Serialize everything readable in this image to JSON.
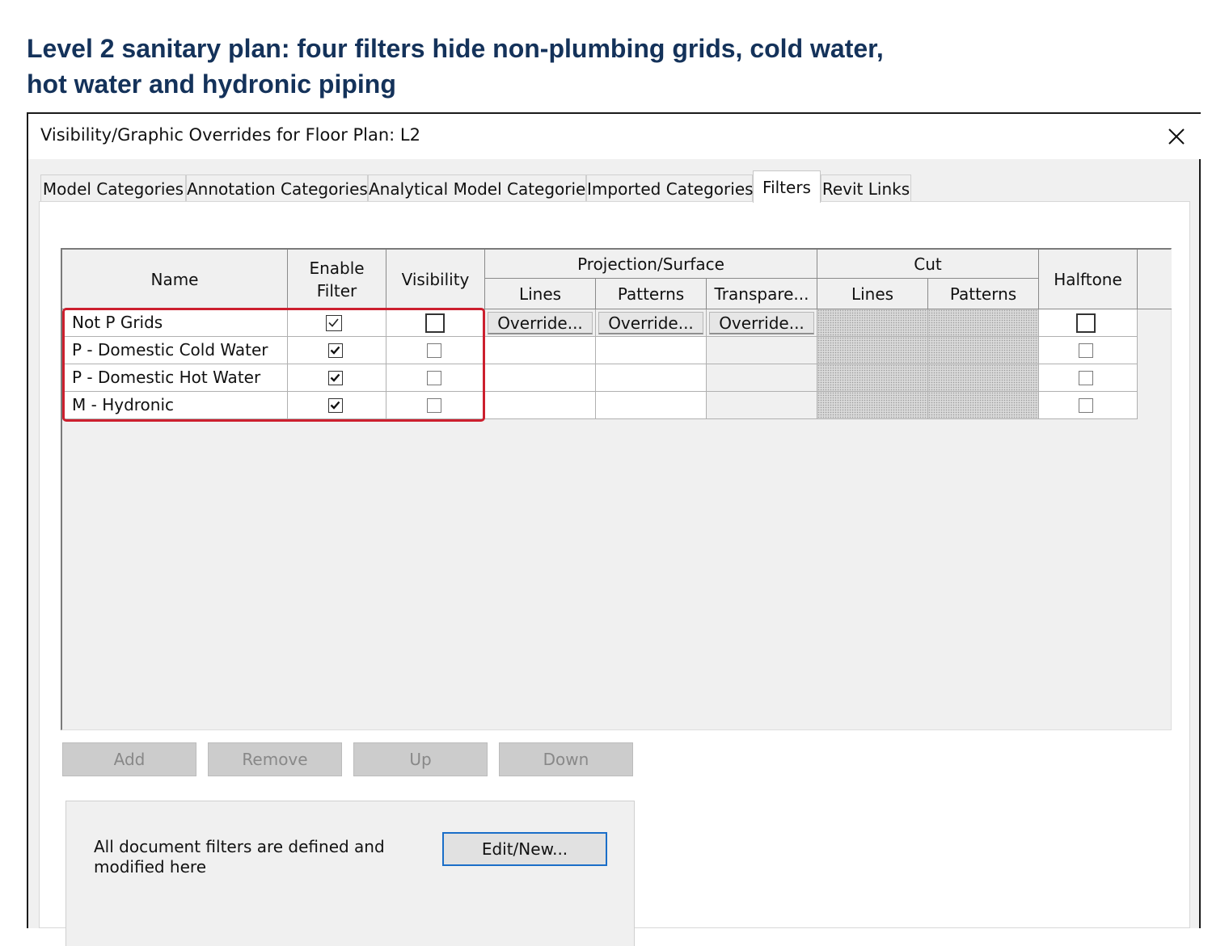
{
  "caption": {
    "line1": "Level 2 sanitary plan: four filters hide non-plumbing grids, cold water,",
    "line2": "hot water and hydronic piping"
  },
  "dialog": {
    "title": "Visibility/Graphic Overrides for Floor Plan: L2",
    "close_icon": "close-icon"
  },
  "tabs": [
    {
      "label": "Model Categories",
      "active": false
    },
    {
      "label": "Annotation Categories",
      "active": false
    },
    {
      "label": "Analytical Model Categories",
      "active": false
    },
    {
      "label": "Imported Categories",
      "active": false
    },
    {
      "label": "Filters",
      "active": true
    },
    {
      "label": "Revit Links",
      "active": false
    }
  ],
  "table": {
    "headers": {
      "name": "Name",
      "enable_filter_line1": "Enable",
      "enable_filter_line2": "Filter",
      "visibility": "Visibility",
      "projection_surface": "Projection/Surface",
      "proj_lines": "Lines",
      "proj_patterns": "Patterns",
      "proj_transparency": "Transpare...",
      "cut": "Cut",
      "cut_lines": "Lines",
      "cut_patterns": "Patterns",
      "halftone": "Halftone"
    },
    "rows": [
      {
        "name": "Not P Grids",
        "enable_filter": true,
        "visibility": false,
        "halftone": false,
        "override_lines": "Override...",
        "override_patterns": "Override...",
        "override_transparency": "Override..."
      },
      {
        "name": "P - Domestic Cold Water",
        "enable_filter": true,
        "visibility": false,
        "halftone": false
      },
      {
        "name": "P - Domestic Hot Water",
        "enable_filter": true,
        "visibility": false,
        "halftone": false
      },
      {
        "name": "M - Hydronic",
        "enable_filter": true,
        "visibility": false,
        "halftone": false
      }
    ]
  },
  "buttons": {
    "add": "Add",
    "remove": "Remove",
    "up": "Up",
    "down": "Down"
  },
  "footer": {
    "description_line1": "All document filters are defined and",
    "description_line2": "modified here",
    "edit_new": "Edit/New..."
  },
  "colors": {
    "caption": "#14325a",
    "highlight": "#cc1f2e",
    "default_button_border": "#1a6ec8"
  }
}
